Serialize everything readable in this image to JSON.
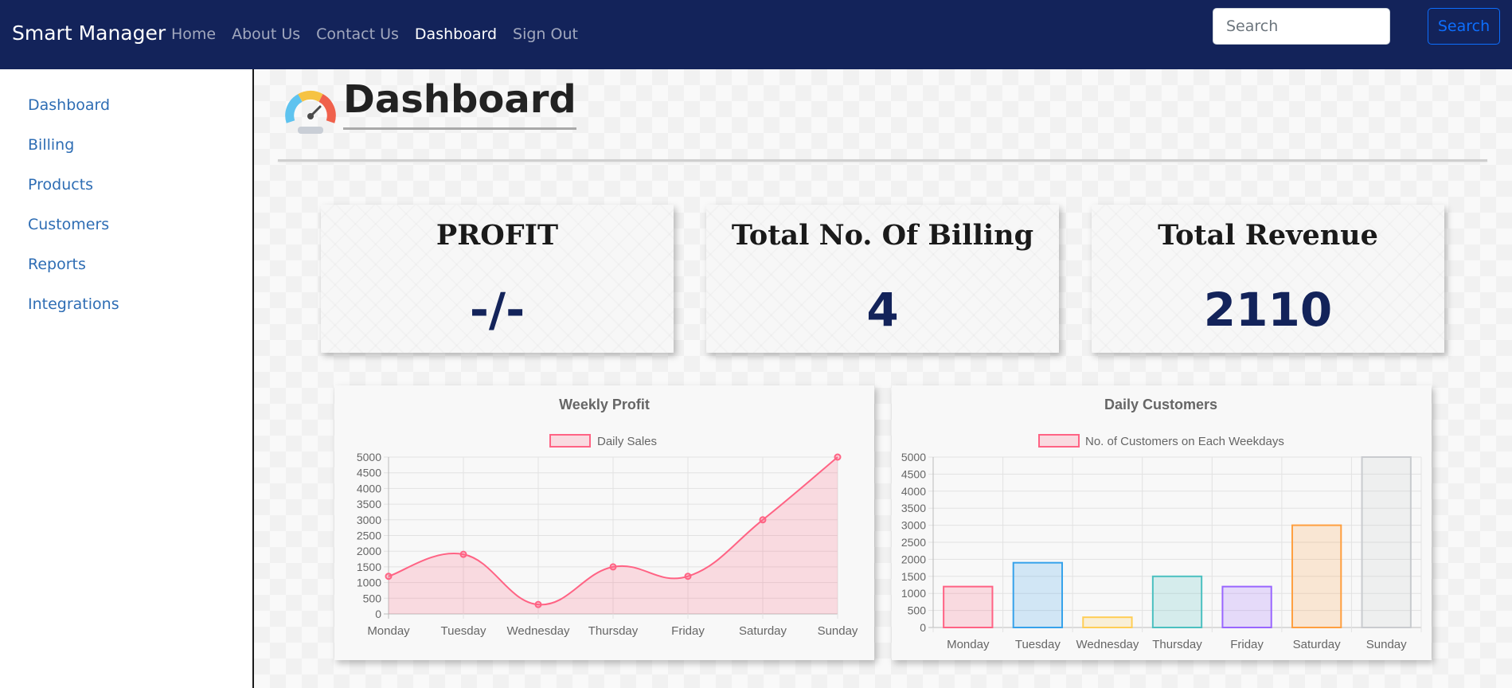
{
  "navbar": {
    "brand": "Smart Manager",
    "links": [
      "Home",
      "About Us",
      "Contact Us",
      "Dashboard",
      "Sign Out"
    ],
    "active_link": "Dashboard",
    "search_placeholder": "Search",
    "search_button": "Search",
    "bg_color": "#13235a"
  },
  "sidebar": {
    "items": [
      "Dashboard",
      "Billing",
      "Products",
      "Customers",
      "Reports",
      "Integrations"
    ]
  },
  "page": {
    "title": "Dashboard",
    "icon": "speedometer-icon"
  },
  "stats": [
    {
      "title": "PROFIT",
      "value": "-/-"
    },
    {
      "title": "Total No. Of Billing",
      "value": "4"
    },
    {
      "title": "Total Revenue",
      "value": "2110"
    }
  ],
  "chart_data": [
    {
      "type": "line",
      "title": "Weekly Profit",
      "categories": [
        "Monday",
        "Tuesday",
        "Wednesday",
        "Thursday",
        "Friday",
        "Saturday",
        "Sunday"
      ],
      "series": [
        {
          "name": "Daily Sales",
          "values": [
            1200,
            1900,
            300,
            1500,
            1200,
            3000,
            5000
          ],
          "color": "#ff6384"
        }
      ],
      "ylim": [
        0,
        5000
      ],
      "yticks": [
        0,
        500,
        1000,
        1500,
        2000,
        2500,
        3000,
        3500,
        4000,
        4500,
        5000
      ],
      "fill": true,
      "grid": true,
      "legend": "top"
    },
    {
      "type": "bar",
      "title": "Daily Customers",
      "categories": [
        "Monday",
        "Tuesday",
        "Wednesday",
        "Thursday",
        "Friday",
        "Saturday",
        "Sunday"
      ],
      "series": [
        {
          "name": "No. of Customers on Each Weekdays",
          "values": [
            1200,
            1900,
            300,
            1500,
            1200,
            3000,
            5000
          ]
        }
      ],
      "bar_colors": [
        "#ff6384",
        "#36a2eb",
        "#ffce56",
        "#4bc0c0",
        "#9966ff",
        "#ff9f40",
        "#c9cbcf"
      ],
      "ylim": [
        0,
        5000
      ],
      "yticks": [
        0,
        500,
        1000,
        1500,
        2000,
        2500,
        3000,
        3500,
        4000,
        4500,
        5000
      ],
      "grid": true,
      "legend": "top"
    }
  ]
}
